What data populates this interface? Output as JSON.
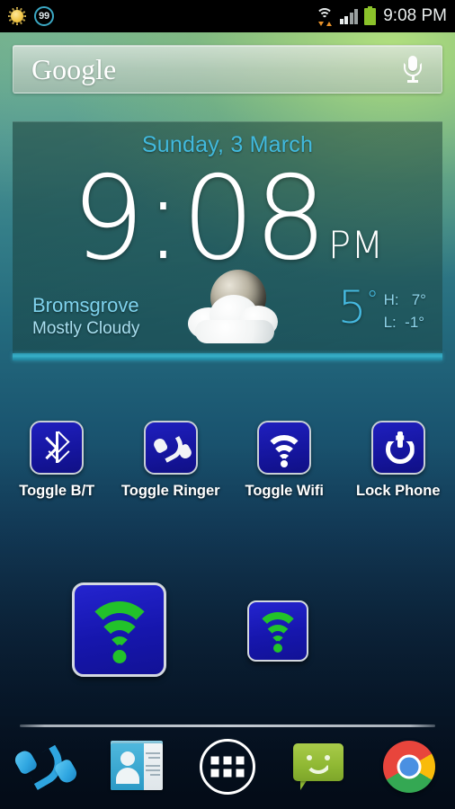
{
  "status_bar": {
    "left_icons": [
      {
        "name": "brightness-sun-icon",
        "label": "sun"
      },
      {
        "name": "notification-count-badge",
        "label": "99"
      }
    ],
    "notification_count": "99",
    "wifi_icon": "wifi-signal-icon",
    "cell_signal_icon": "cell-signal-icon",
    "battery_icon": "battery-full-icon",
    "clock": "9:08 PM"
  },
  "search": {
    "brand": "Google",
    "placeholder": "Google",
    "voice_icon": "microphone-icon"
  },
  "widget": {
    "date": "Sunday, 3 March",
    "time": "9:08",
    "meridiem": "PM",
    "city": "Bromsgrove",
    "condition": "Mostly Cloudy",
    "weather_icon": "moon-behind-cloud-icon",
    "temperature": "5",
    "degree": "°",
    "high_label": "H:",
    "high_value": "7°",
    "low_label": "L:",
    "low_value": "-1°",
    "high_line": "H:   7°",
    "low_line": "L:  -1°",
    "accent_color": "#37b0c8",
    "date_color": "#41b9dd",
    "temp_color": "#45b9e0"
  },
  "shortcuts": [
    {
      "label": "Toggle B/T",
      "icon": "bluetooth-icon"
    },
    {
      "label": "Toggle Ringer",
      "icon": "phone-handset-icon"
    },
    {
      "label": "Toggle Wifi",
      "icon": "wifi-icon"
    },
    {
      "label": "Lock Phone",
      "icon": "power-icon"
    }
  ],
  "wifi_widgets": [
    {
      "name": "wifi-toggle-widget-large",
      "icon": "wifi-icon",
      "state_color": "#22c22a"
    },
    {
      "name": "wifi-toggle-widget-small",
      "icon": "wifi-icon",
      "state_color": "#22c22a"
    }
  ],
  "dock": [
    {
      "name": "dock-phone",
      "icon": "phone-icon"
    },
    {
      "name": "dock-contacts",
      "icon": "contacts-icon"
    },
    {
      "name": "dock-app-drawer",
      "icon": "apps-grid-icon"
    },
    {
      "name": "dock-messaging",
      "icon": "messaging-icon"
    },
    {
      "name": "dock-browser",
      "icon": "chrome-icon"
    }
  ],
  "theme": {
    "tile_blue": "#1616ad",
    "tile_border": "#c8cfd6",
    "wifi_green": "#22c22a",
    "status_bar_bg": "#000000"
  }
}
